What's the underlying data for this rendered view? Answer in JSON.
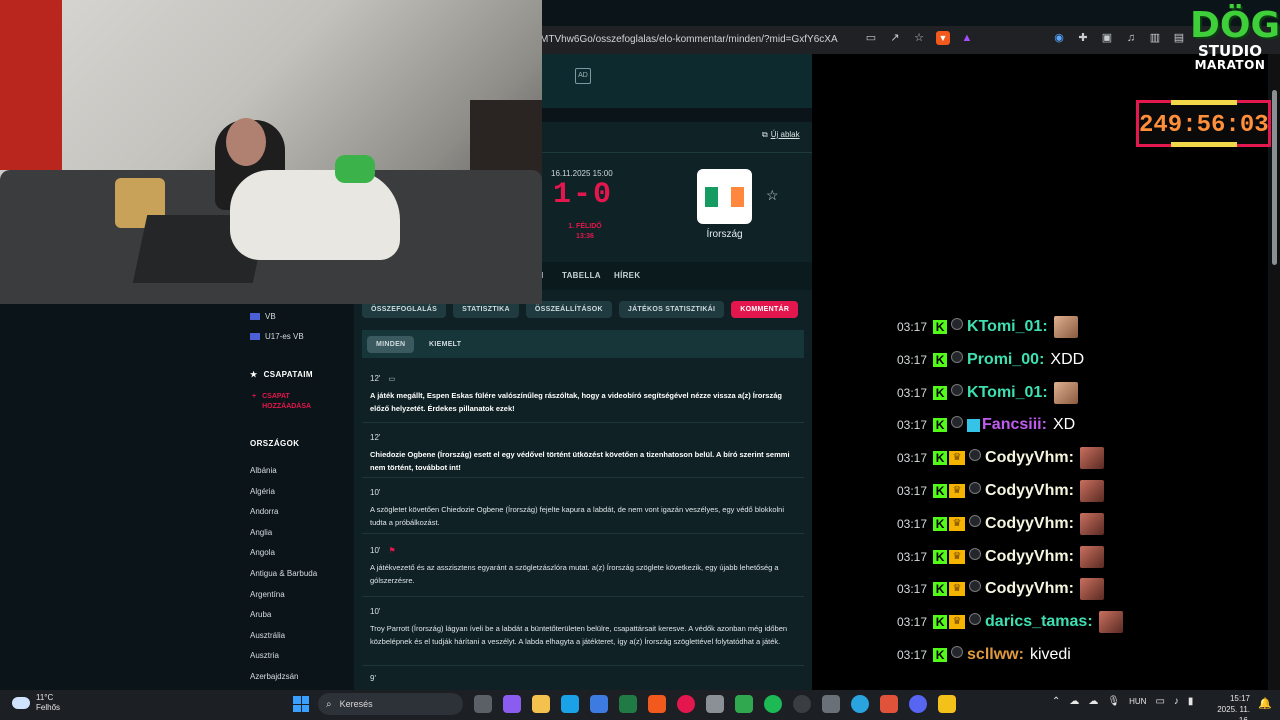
{
  "browser": {
    "url": "MTVhw6Go/osszefoglalas/elo-kommentar/minden/?mid=GxfY6cXA"
  },
  "page": {
    "ad_label": "AD",
    "new_window": "Új ablak",
    "match": {
      "date": "16.11.2025 15:00",
      "score": "1-0",
      "period": "1. FÉLIDŐ",
      "clock": "13:36",
      "team": "Írország",
      "flag_colors": [
        "#169b62",
        "#ffffff",
        "#ff883e"
      ]
    },
    "subtabs": [
      {
        "label": "I"
      },
      {
        "label": "TABELLA"
      },
      {
        "label": "HÍREK"
      }
    ],
    "tabs": [
      {
        "label": "ÖSSZEFOGLALÁS"
      },
      {
        "label": "STATISZTIKA"
      },
      {
        "label": "ÖSSZEÁLLÍTÁSOK"
      },
      {
        "label": "JÁTÉKOS STATISZTIKÁI"
      },
      {
        "label": "KOMMENTÁR"
      }
    ],
    "filters": [
      {
        "label": "MINDEN"
      },
      {
        "label": "KIEMELT"
      }
    ],
    "commentary": [
      {
        "minute": "12'",
        "text": "A játék megállt, Espen Eskas fülére valószínűleg rászóltak, hogy a videobíró segítségével nézze vissza a(z) Írország előző helyzetét. Érdekes pillanatok ezek!"
      },
      {
        "minute": "12'",
        "text": "Chiedozie Ogbene (Írország) esett el egy védővel történt ütközést követően a tizenhatoson belül. A bíró szerint semmi nem történt, továbbot int!"
      },
      {
        "minute": "10'",
        "text": "A szögletet követően Chiedozie Ogbene (Írország) fejelte kapura a labdát, de nem vont igazán veszélyes, egy védő blokkolni tudta a próbálkozást."
      },
      {
        "minute": "10'",
        "text": "A játékvezető és az asszisztens egyaránt a szögletzászlóra mutat. a(z) Írország szöglete következik, egy újabb lehetőség a gólszerzésre."
      },
      {
        "minute": "10'",
        "text": "Troy Parrott (Írország) lágyan íveli be a labdát a büntetőterületen belülre, csapattársait keresve. A védők azonban még időben közbelépnek és el tudják hárítani a veszélyt. A labda elhagyta a játékteret, így a(z) Írország szöglettével folytatódhat a játék."
      },
      {
        "minute": "9'",
        "text": ""
      }
    ]
  },
  "sidebar": {
    "competitions": [
      {
        "label": "VB"
      },
      {
        "label": "U17-es VB"
      }
    ],
    "my_teams": "CSAPATAIM",
    "add_team": [
      "CSAPAT",
      "HOZZÁADÁSA"
    ],
    "countries_title": "ORSZÁGOK",
    "countries": [
      "Albánia",
      "Algéria",
      "Andorra",
      "Anglia",
      "Angola",
      "Antigua & Barbuda",
      "Argentína",
      "Aruba",
      "Ausztrália",
      "Ausztria",
      "Azerbajdzsán"
    ]
  },
  "overlay": {
    "logo": {
      "line1": "DÖG",
      "line2": "STUDIO",
      "line3": "MARATON"
    },
    "timer": "249:56:03"
  },
  "chat": [
    {
      "time": "03:17",
      "user": "KTomi_01:",
      "color": "#3ee0b0",
      "text": "",
      "emote": true,
      "crown": false,
      "cube": false
    },
    {
      "time": "03:17",
      "user": "Promi_00:",
      "color": "#3ee0b0",
      "text": "XDD",
      "emote": false,
      "crown": false,
      "cube": false
    },
    {
      "time": "03:17",
      "user": "KTomi_01:",
      "color": "#3ee0b0",
      "text": "",
      "emote": true,
      "crown": false,
      "cube": false
    },
    {
      "time": "03:17",
      "user": "Fancsiii:",
      "color": "#c05cf0",
      "text": "XD",
      "emote": false,
      "crown": false,
      "cube": true
    },
    {
      "time": "03:17",
      "user": "CodyyVhm:",
      "color": "#f5f5e0",
      "text": "",
      "emote": true,
      "crown": true,
      "cube": false
    },
    {
      "time": "03:17",
      "user": "CodyyVhm:",
      "color": "#f5f5e0",
      "text": "",
      "emote": true,
      "crown": true,
      "cube": false
    },
    {
      "time": "03:17",
      "user": "CodyyVhm:",
      "color": "#f5f5e0",
      "text": "",
      "emote": true,
      "crown": true,
      "cube": false
    },
    {
      "time": "03:17",
      "user": "CodyyVhm:",
      "color": "#f5f5e0",
      "text": "",
      "emote": true,
      "crown": true,
      "cube": false
    },
    {
      "time": "03:17",
      "user": "CodyyVhm:",
      "color": "#f5f5e0",
      "text": "",
      "emote": true,
      "crown": true,
      "cube": false
    },
    {
      "time": "03:17",
      "user": "darics_tamas:",
      "color": "#3ee0b0",
      "text": "",
      "emote": true,
      "crown": true,
      "cube": false
    },
    {
      "time": "03:17",
      "user": "scllww:",
      "color": "#e09a3e",
      "text": "kivedi",
      "emote": false,
      "crown": false,
      "cube": false
    }
  ],
  "taskbar": {
    "weather_temp": "11°C",
    "weather_desc": "Felhős",
    "search": "Keresés",
    "lang": "HUN",
    "time": "15:17",
    "date": "2025. 11. 16."
  }
}
